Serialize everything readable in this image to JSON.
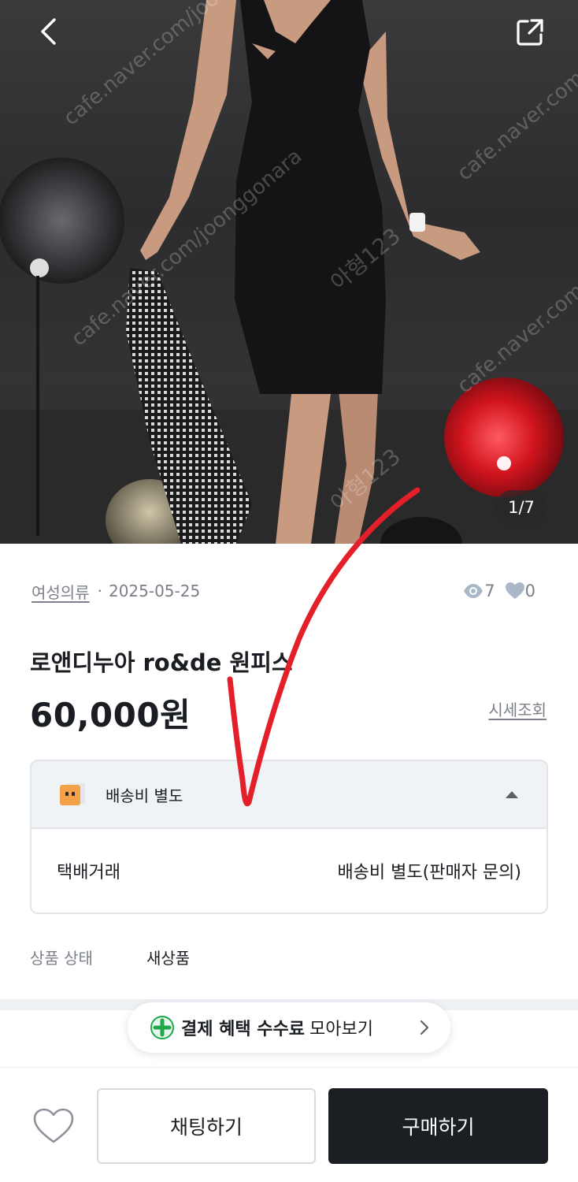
{
  "product_image": {
    "counter": "1/7",
    "watermark_lines": [
      "cafe.naver.com/joonggonara",
      "아형123"
    ]
  },
  "meta": {
    "category": "여성의류",
    "date": "2025-05-25",
    "views": "7",
    "likes": "0"
  },
  "product": {
    "title": "로앤디누아 ro&de 원피스",
    "price": "60,000원",
    "market_price_link": "시세조회"
  },
  "shipping": {
    "header_label": "배송비 별도",
    "method": "택배거래",
    "fee": "배송비 별도(판매자 문의)"
  },
  "condition": {
    "label": "상품 상태",
    "value": "새상품"
  },
  "promo": {
    "bold": "결제 혜택 수수료",
    "rest": "모아보기"
  },
  "actions": {
    "chat": "채팅하기",
    "buy": "구매하기"
  },
  "colors": {
    "accent_dark": "#1b1e23",
    "muted": "#7b808a",
    "promo_green": "#1fa84a",
    "annotation_red": "#e3202a"
  }
}
